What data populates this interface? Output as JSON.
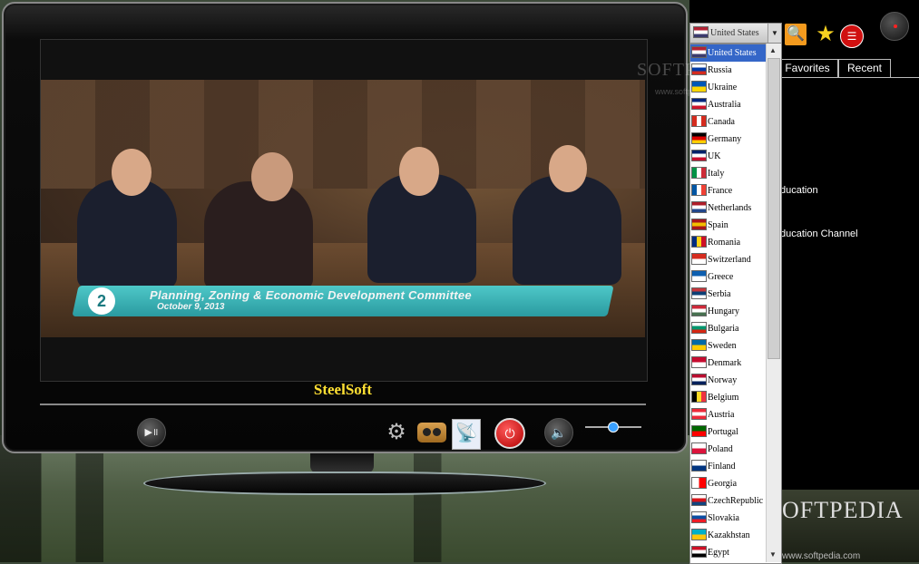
{
  "tv": {
    "brand": "SteelSoft",
    "banner_number": "2",
    "banner_title": "Planning, Zoning & Economic Development Committee",
    "banner_date": "October 9, 2013"
  },
  "controls": {
    "play_glyph": "▶॥",
    "gear_glyph": "⚙",
    "dish_glyph": "📡",
    "power_glyph": "⏻",
    "speaker_glyph": "🔈",
    "volume_level": 0.45
  },
  "panel": {
    "selected_country": "United States",
    "select_arrow": "▼",
    "search_glyph": "🔍",
    "favorites_glyph": "★",
    "list_glyph": "☰",
    "tabs": [
      {
        "label": "Favorites"
      },
      {
        "label": "Recent"
      }
    ],
    "channels": [
      {
        "label": "ducation"
      },
      {
        "label": "ducation Channel"
      }
    ],
    "watermark_top": "SOFTPEDIA",
    "watermark_url_top": "www.softpedia.com",
    "watermark_bottom": "OFTPEDIA",
    "watermark_url_bottom": "www.softpedia.com"
  },
  "dropdown": {
    "up_arrow": "▲",
    "down_arrow": "▼",
    "items": [
      {
        "name": "United States",
        "icon": "flag-us"
      },
      {
        "name": "Russia",
        "icon": "flag-ru"
      },
      {
        "name": "Ukraine",
        "icon": "flag-ua"
      },
      {
        "name": "Australia",
        "icon": "flag-au"
      },
      {
        "name": "Canada",
        "icon": "flag-ca"
      },
      {
        "name": "Germany",
        "icon": "flag-de"
      },
      {
        "name": "UK",
        "icon": "flag-uk"
      },
      {
        "name": "Italy",
        "icon": "flag-it"
      },
      {
        "name": "France",
        "icon": "flag-fr"
      },
      {
        "name": "Netherlands",
        "icon": "flag-nl"
      },
      {
        "name": "Spain",
        "icon": "flag-es"
      },
      {
        "name": "Romania",
        "icon": "flag-ro"
      },
      {
        "name": "Switzerland",
        "icon": "flag-ch"
      },
      {
        "name": "Greece",
        "icon": "flag-gr"
      },
      {
        "name": "Serbia",
        "icon": "flag-rs"
      },
      {
        "name": "Hungary",
        "icon": "flag-hu"
      },
      {
        "name": "Bulgaria",
        "icon": "flag-bg"
      },
      {
        "name": "Sweden",
        "icon": "flag-se"
      },
      {
        "name": "Denmark",
        "icon": "flag-dk"
      },
      {
        "name": "Norway",
        "icon": "flag-no"
      },
      {
        "name": "Belgium",
        "icon": "flag-be"
      },
      {
        "name": "Austria",
        "icon": "flag-at"
      },
      {
        "name": "Portugal",
        "icon": "flag-pt"
      },
      {
        "name": "Poland",
        "icon": "flag-pl"
      },
      {
        "name": "Finland",
        "icon": "flag-fi"
      },
      {
        "name": "Georgia",
        "icon": "flag-ge"
      },
      {
        "name": "CzechRepublic",
        "icon": "flag-cz"
      },
      {
        "name": "Slovakia",
        "icon": "flag-sk"
      },
      {
        "name": "Kazakhstan",
        "icon": "flag-kz"
      },
      {
        "name": "Egypt",
        "icon": "flag-eg"
      }
    ]
  },
  "flag_colors": {
    "flag-us": [
      "#b22234",
      "#ffffff",
      "#3c3b6e"
    ],
    "flag-ru": [
      "#ffffff",
      "#0039a6",
      "#d52b1e"
    ],
    "flag-ua": [
      "#0057b7",
      "#ffd700"
    ],
    "flag-au": [
      "#00247d",
      "#ffffff",
      "#cf142b"
    ],
    "flag-ca": [
      "#d52b1e",
      "#ffffff",
      "#d52b1e"
    ],
    "flag-de": [
      "#000000",
      "#dd0000",
      "#ffce00"
    ],
    "flag-uk": [
      "#012169",
      "#ffffff",
      "#c8102e"
    ],
    "flag-it": [
      "#009246",
      "#ffffff",
      "#ce2b37"
    ],
    "flag-fr": [
      "#0055a4",
      "#ffffff",
      "#ef4135"
    ],
    "flag-nl": [
      "#ae1c28",
      "#ffffff",
      "#21468b"
    ],
    "flag-es": [
      "#aa151b",
      "#f1bf00",
      "#aa151b"
    ],
    "flag-ro": [
      "#002b7f",
      "#fcd116",
      "#ce1126"
    ],
    "flag-ch": [
      "#d52b1e",
      "#ffffff"
    ],
    "flag-gr": [
      "#0d5eaf",
      "#ffffff"
    ],
    "flag-rs": [
      "#c6363c",
      "#0c4076",
      "#ffffff"
    ],
    "flag-hu": [
      "#ce2939",
      "#ffffff",
      "#477050"
    ],
    "flag-bg": [
      "#ffffff",
      "#00966e",
      "#d62612"
    ],
    "flag-se": [
      "#006aa7",
      "#fecc00"
    ],
    "flag-dk": [
      "#c60c30",
      "#ffffff"
    ],
    "flag-no": [
      "#ba0c2f",
      "#ffffff",
      "#00205b"
    ],
    "flag-be": [
      "#000000",
      "#fdda24",
      "#ef3340"
    ],
    "flag-at": [
      "#ed2939",
      "#ffffff",
      "#ed2939"
    ],
    "flag-pt": [
      "#006600",
      "#ff0000"
    ],
    "flag-pl": [
      "#ffffff",
      "#dc143c"
    ],
    "flag-fi": [
      "#ffffff",
      "#003580"
    ],
    "flag-ge": [
      "#ffffff",
      "#ff0000"
    ],
    "flag-cz": [
      "#ffffff",
      "#d7141a",
      "#11457e"
    ],
    "flag-sk": [
      "#ffffff",
      "#0b4ea2",
      "#ee1c25"
    ],
    "flag-kz": [
      "#00afca",
      "#fec50c"
    ],
    "flag-eg": [
      "#ce1126",
      "#ffffff",
      "#000000"
    ]
  }
}
